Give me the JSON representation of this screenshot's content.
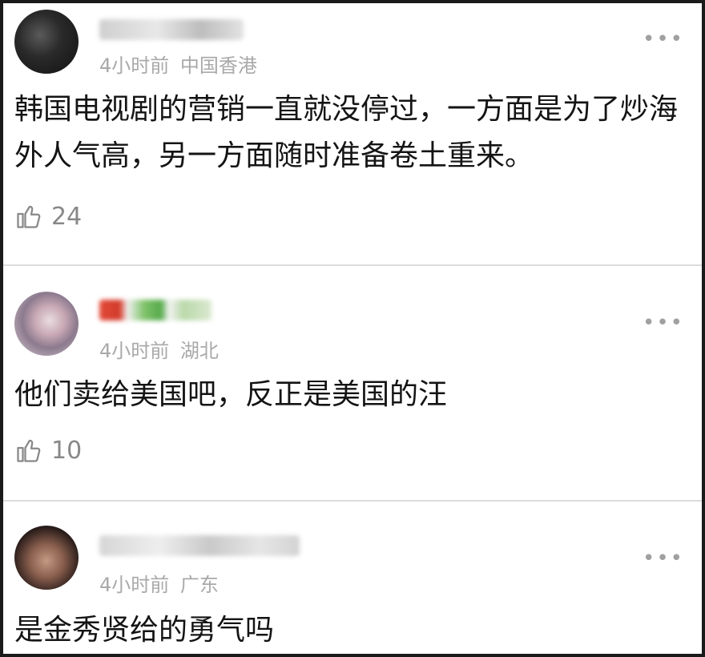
{
  "comments": [
    {
      "time": "4小时前",
      "location": "中国香港",
      "text": "韩国电视剧的营销一直就没停过，一方面是为了炒海外人气高，另一方面随时准备卷土重来。",
      "likes": "24",
      "icons": {
        "avatar": "avatar",
        "more": "more-icon",
        "like": "thumb-up-icon"
      }
    },
    {
      "time": "4小时前",
      "location": "湖北",
      "text": "他们卖给美国吧，反正是美国的汪",
      "likes": "10",
      "icons": {
        "avatar": "avatar",
        "more": "more-icon",
        "like": "thumb-up-icon"
      }
    },
    {
      "time": "4小时前",
      "location": "广东",
      "text": "是金秀贤给的勇气吗",
      "icons": {
        "avatar": "avatar",
        "more": "more-icon"
      }
    }
  ],
  "more_glyph": "•••",
  "colors": {
    "meta_text": "#a9a9a9",
    "divider": "#dcdcdc",
    "body_text": "#141414"
  }
}
